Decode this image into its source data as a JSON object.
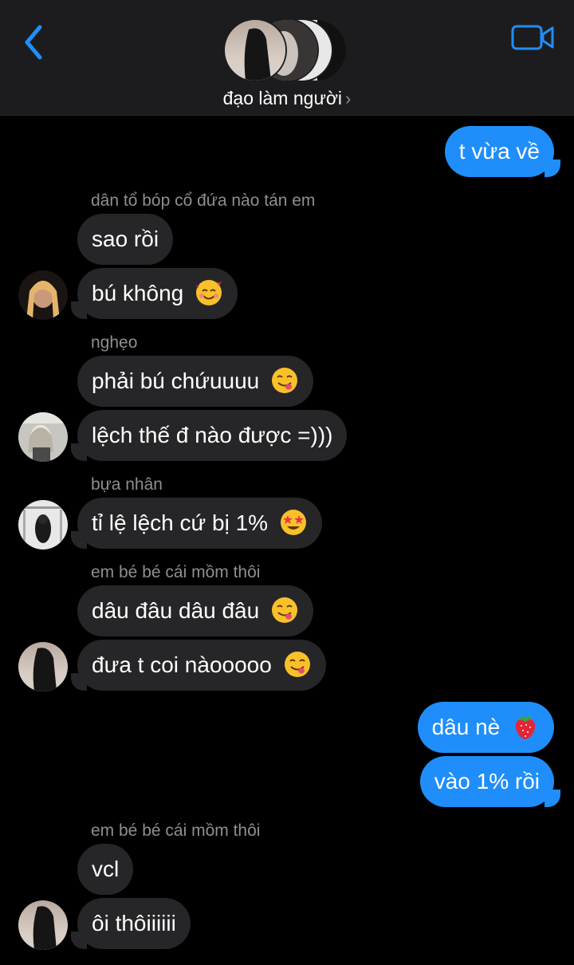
{
  "header": {
    "group_name": "đạo làm người",
    "chevron": "›",
    "back_icon": "chevron-left-icon",
    "video_icon": "video-camera-icon",
    "accent_color": "#1f8efa"
  },
  "messages": {
    "m1": "t vừa về",
    "s1": "dân tổ bóp cổ đứa nào tán em",
    "m2": "sao rồi",
    "m3": "bú không",
    "s2": "nghẹo",
    "m4": "phải bú chứuuuu",
    "m5": "lệch thế đ nào được =)))",
    "s3": "bựa nhân",
    "m6": "tỉ lệ lệch cứ bị 1%",
    "s4": "em bé bé cái mồm thôi",
    "m7": "dâu đâu dâu đâu",
    "m8": "đưa t coi nàooooo",
    "m9": "dâu nè",
    "m10": "vào 1% rồi",
    "s5": "em bé bé cái mồm thôi",
    "m11": "vcl",
    "m12": "ôi thôiiiiii"
  },
  "emojis": {
    "m3": "smiling-face-with-hearts",
    "m4": "face-savoring-food",
    "m6": "star-struck",
    "m7": "face-savoring-food",
    "m8": "face-savoring-food",
    "m9": "strawberry"
  }
}
